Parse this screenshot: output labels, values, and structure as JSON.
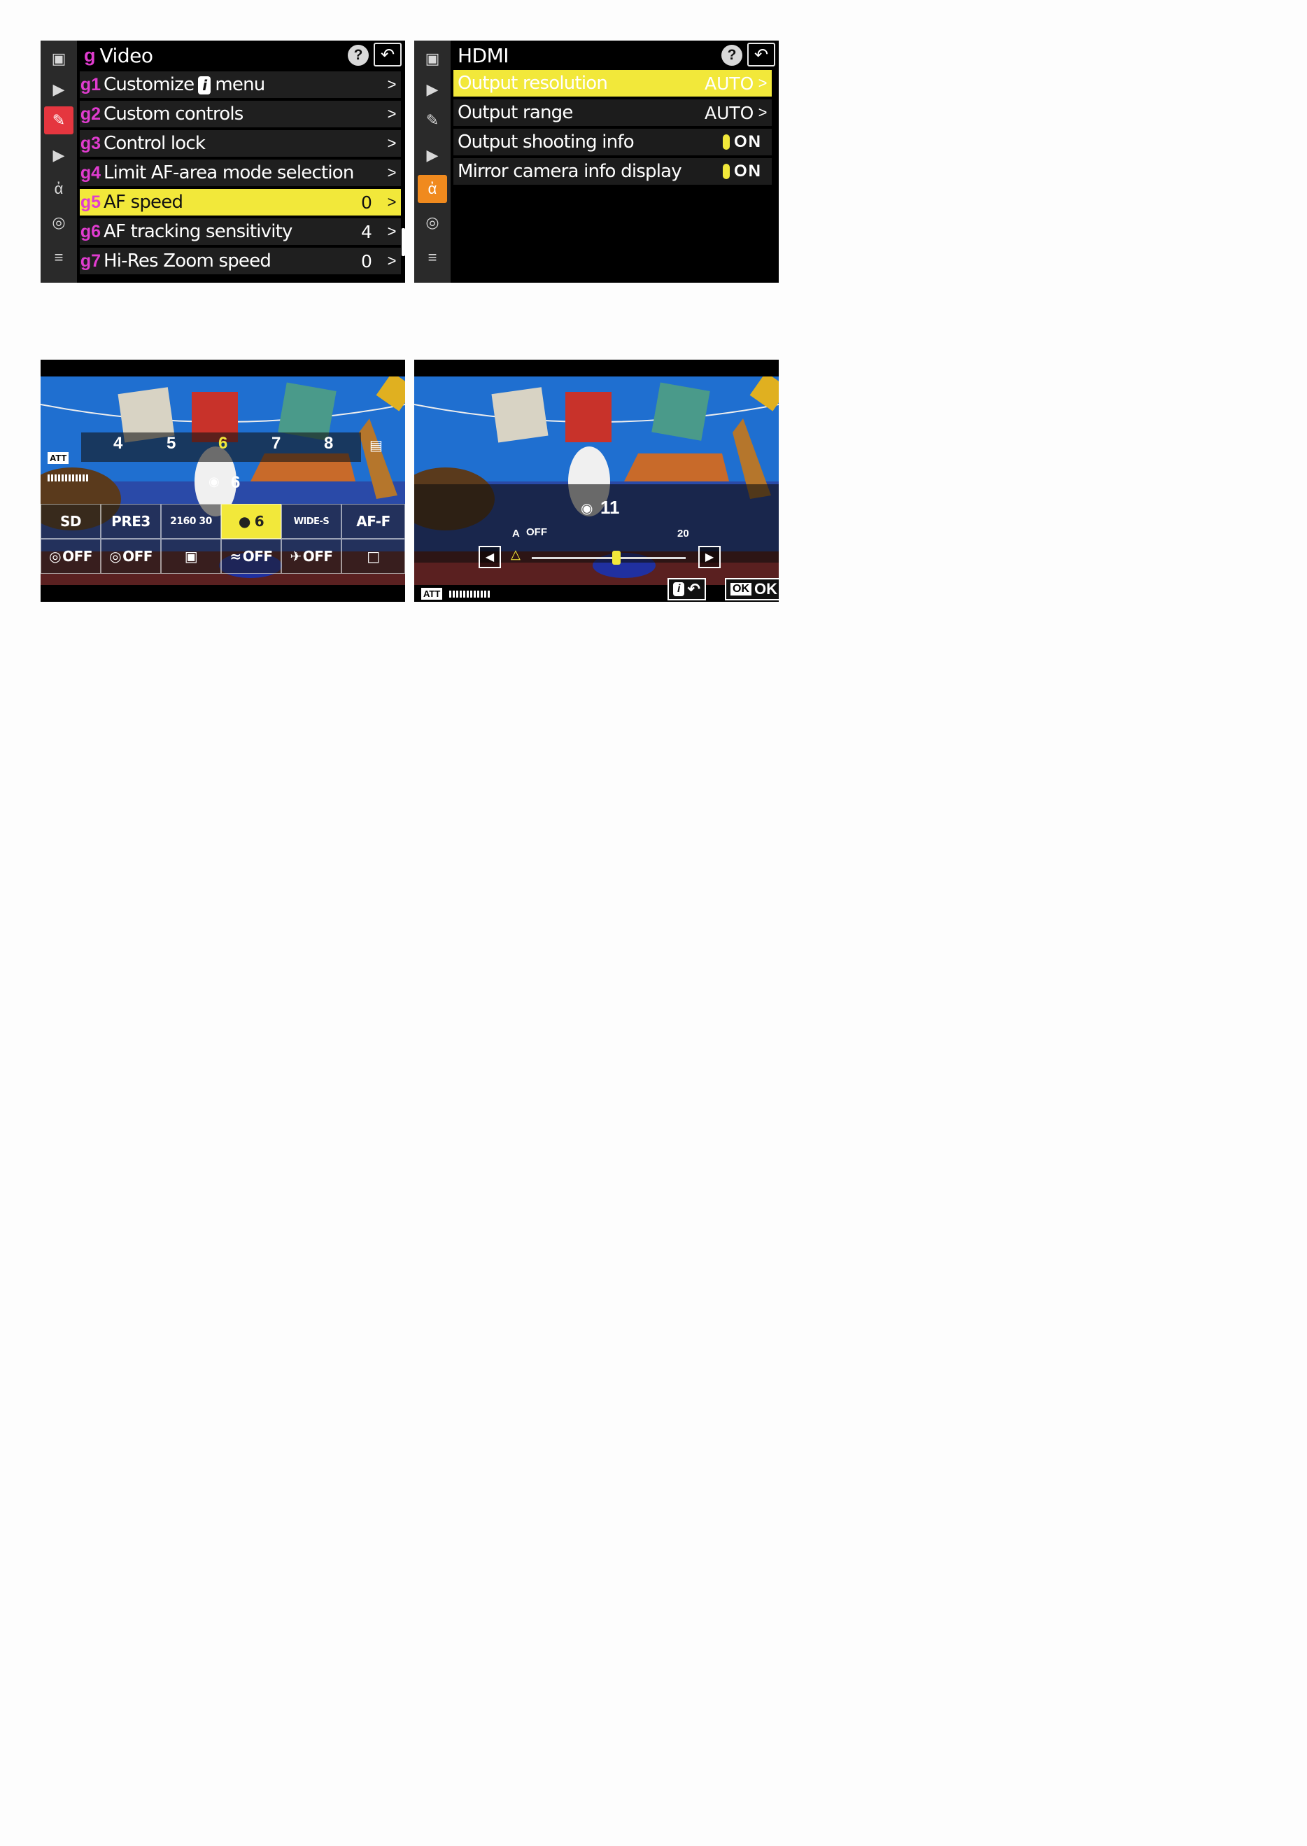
{
  "video_menu": {
    "title_letter": "g",
    "title": "Video",
    "help": "?",
    "items": [
      {
        "code": "g1",
        "label_pre": "Customize",
        "badge": "i",
        "label_post": "menu",
        "value": "",
        "arrow": ">"
      },
      {
        "code": "g2",
        "label": "Custom controls",
        "value": "",
        "arrow": ">"
      },
      {
        "code": "g3",
        "label": "Control lock",
        "value": "",
        "arrow": ">"
      },
      {
        "code": "g4",
        "label": "Limit AF-area mode selection",
        "value": "",
        "arrow": ">"
      },
      {
        "code": "g5",
        "label": "AF speed",
        "value": "0",
        "arrow": ">",
        "selected": true
      },
      {
        "code": "g6",
        "label": "AF tracking sensitivity",
        "value": "4",
        "arrow": ">"
      },
      {
        "code": "g7",
        "label": "Hi-Res Zoom speed",
        "value": "0",
        "arrow": ">"
      }
    ]
  },
  "hdmi_menu": {
    "title": "HDMI",
    "help": "?",
    "items": [
      {
        "label": "Output resolution",
        "value": "AUTO",
        "arrow": ">",
        "selected": true
      },
      {
        "label": "Output range",
        "value": "AUTO",
        "arrow": ">"
      },
      {
        "label": "Output shooting info",
        "value": "ON"
      },
      {
        "label": "Mirror camera info display",
        "value": "ON"
      }
    ]
  },
  "liveview_af": {
    "scale": [
      "4",
      "5",
      "6",
      "7",
      "8"
    ],
    "highlighted": "6",
    "indicator_value": "6",
    "att": "ATT",
    "grid_row1": [
      "SD",
      "PRE3",
      "2160 30",
      "6",
      "WIDE-S",
      "AF-F"
    ],
    "grid_row2": [
      "OFF",
      "OFF",
      "",
      "OFF",
      "OFF",
      ""
    ]
  },
  "liveview_mic": {
    "mic_value": "11",
    "label_a": "A",
    "label_off": "OFF",
    "label_max": "20",
    "att": "ATT",
    "ok_label": "OK",
    "level": 0.55
  },
  "colors": {
    "highlight": "#f2e83a",
    "menu_code": "#e03ccf",
    "active_tab_red": "#e5363f",
    "active_tab_orange": "#f08a1e"
  }
}
